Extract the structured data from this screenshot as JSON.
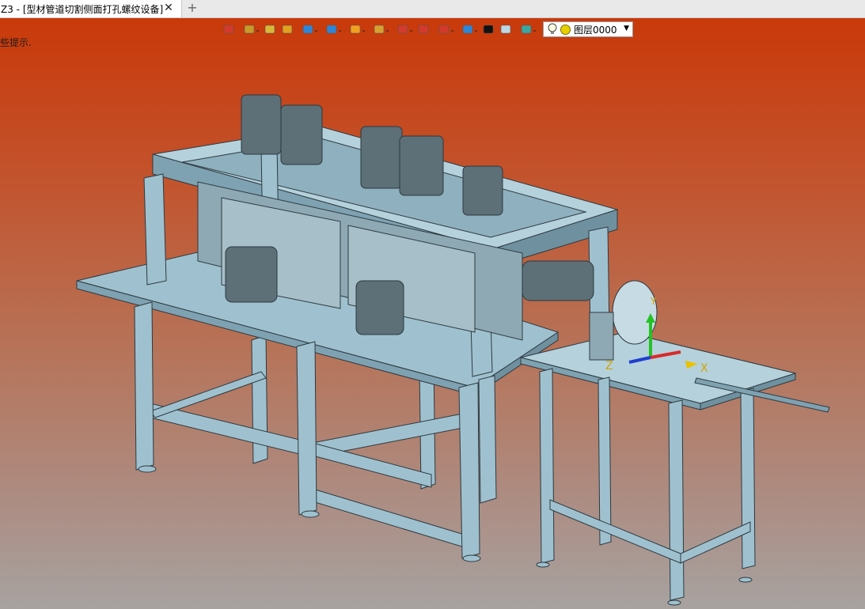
{
  "tab": {
    "title": "Z3 - [型材管道切割侧面打孔螺纹设备]",
    "close": "✕",
    "add": "+"
  },
  "hint": "些提示.",
  "toolbar": {
    "buttons": [
      {
        "name": "exit-sketch-icon",
        "dropdown": false,
        "color": "#d33a2c"
      },
      {
        "name": "hand-pick-icon",
        "dropdown": true,
        "color": "#c79a2a"
      },
      {
        "name": "pen-icon",
        "dropdown": false,
        "color": "#d8b83a"
      },
      {
        "name": "solid-box-icon",
        "dropdown": false,
        "color": "#e0a020"
      },
      {
        "name": "cube-icon",
        "dropdown": true,
        "color": "#2f86d6"
      },
      {
        "name": "face-icon",
        "dropdown": true,
        "color": "#2f86d6"
      },
      {
        "name": "snap-icon",
        "dropdown": true,
        "color": "#f0a020"
      },
      {
        "name": "zoom-icon",
        "dropdown": true,
        "color": "#d8a030"
      },
      {
        "name": "rotate-view-icon",
        "dropdown": true,
        "color": "#d33a2c"
      },
      {
        "name": "fit-view-icon",
        "dropdown": false,
        "color": "#d33a2c"
      },
      {
        "name": "section-icon",
        "dropdown": true,
        "color": "#d33a2c"
      },
      {
        "name": "display-icon",
        "dropdown": true,
        "color": "#2f86d6"
      },
      {
        "name": "line-style-icon",
        "dropdown": false,
        "color": "#111111"
      },
      {
        "name": "color-swatch-icon",
        "dropdown": false,
        "color": "#bcd8e6"
      },
      {
        "name": "layers-icon",
        "dropdown": true,
        "color": "#3aa6a0"
      }
    ],
    "layer_name": "图层0000"
  },
  "axes": {
    "x": "X",
    "y": "Y",
    "z": "Z"
  },
  "colors": {
    "model": "#9fc1cf",
    "edge": "#2c3a40",
    "bg_top": "#c9390a",
    "bg_bottom": "#a7a2a0"
  }
}
